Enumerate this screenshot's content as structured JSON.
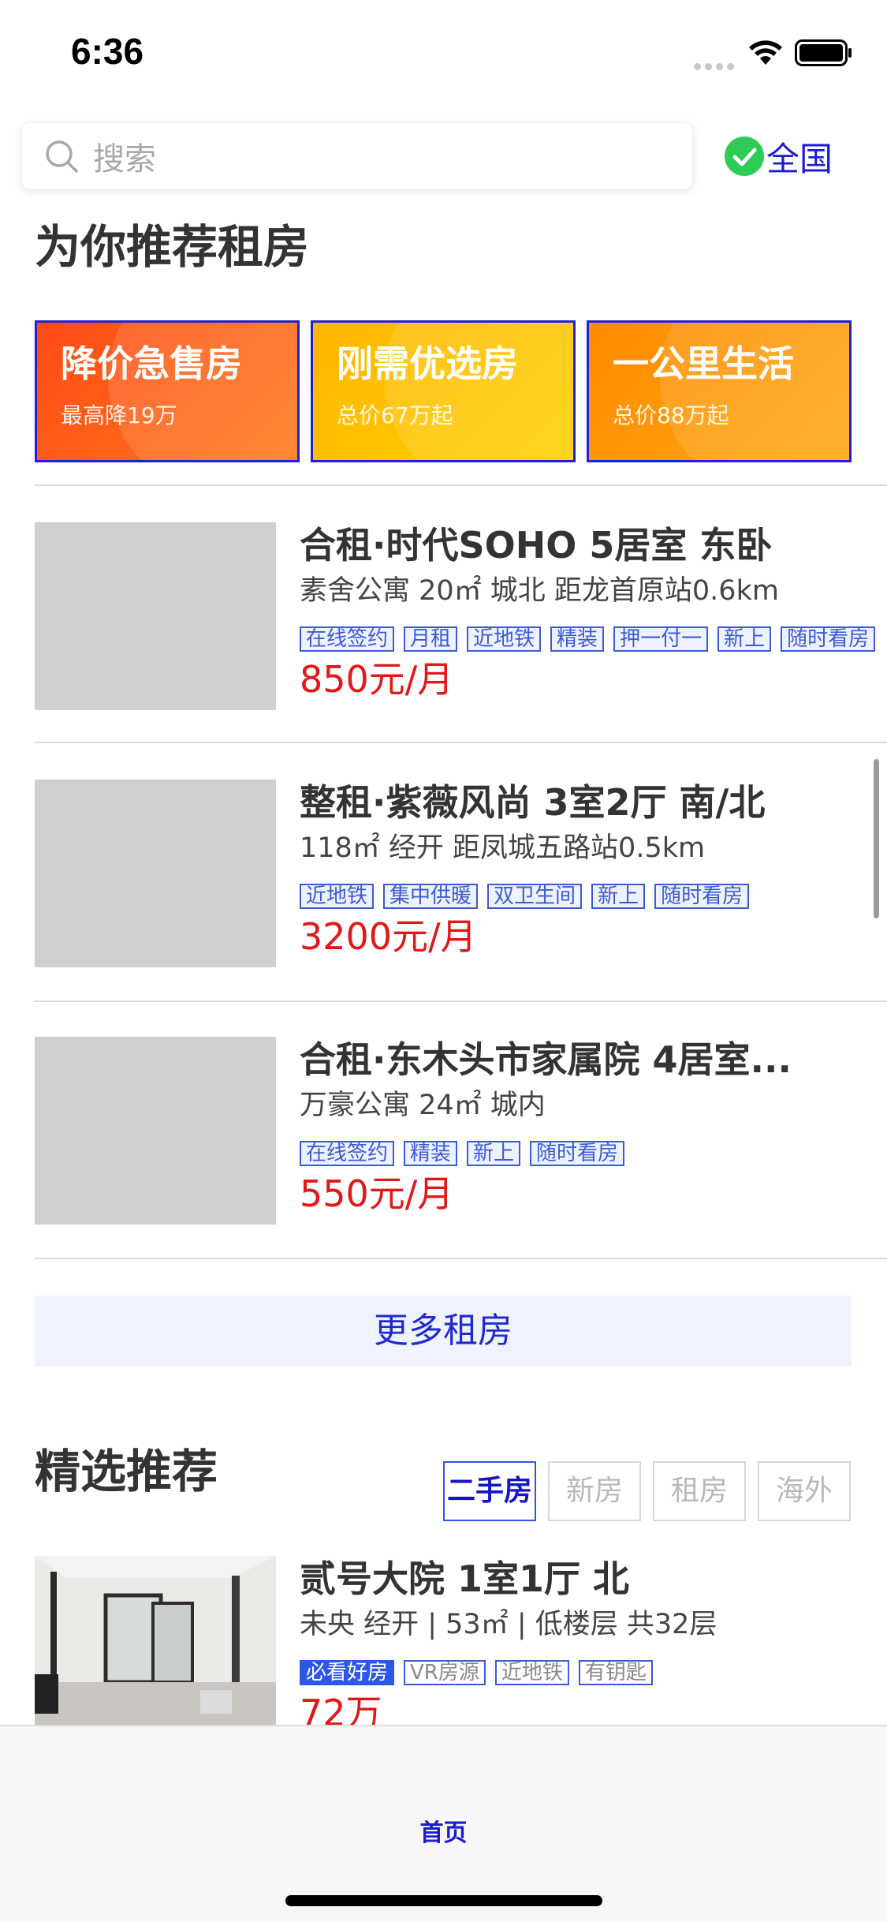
{
  "status_bar": {
    "time": "6:36"
  },
  "search": {
    "placeholder": "搜索"
  },
  "region": {
    "label": "全国"
  },
  "rent_section": {
    "title": "为你推荐租房"
  },
  "promos": [
    {
      "title": "降价急售房",
      "subtitle": "最高降19万",
      "color_from": "#ff4a16",
      "color_to": "#ff7a1a"
    },
    {
      "title": "刚需优选房",
      "subtitle": "总价67万起",
      "color_from": "#ffb600",
      "color_to": "#ffd000"
    },
    {
      "title": "一公里生活",
      "subtitle": "总价88万起",
      "color_from": "#ff8a00",
      "color_to": "#ffa812"
    }
  ],
  "listings": [
    {
      "title": "合租·时代SOHO 5居室 东卧",
      "subtitle": "素舍公寓  20㎡ 城北 距龙首原站0.6km",
      "tags": [
        "在线签约",
        "月租",
        "近地铁",
        "精装",
        "押一付一",
        "新上",
        "随时看房"
      ],
      "price": "850元/月"
    },
    {
      "title": "整租·紫薇风尚 3室2厅 南/北",
      "subtitle": " 118㎡ 经开 距凤城五路站0.5km",
      "tags": [
        "近地铁",
        "集中供暖",
        "双卫生间",
        "新上",
        "随时看房"
      ],
      "price": "3200元/月"
    },
    {
      "title": "合租·东木头市家属院 4居室...",
      "subtitle": "万豪公寓  24㎡ 城内",
      "tags": [
        "在线签约",
        "精装",
        "新上",
        "随时看房"
      ],
      "price": "550元/月"
    }
  ],
  "more_rent": {
    "label": "更多租房"
  },
  "featured": {
    "title": "精选推荐",
    "tabs": [
      "二手房",
      "新房",
      "租房",
      "海外"
    ],
    "active_tab": "二手房",
    "listing": {
      "title": "贰号大院 1室1厅 北",
      "subtitle": "未央 经开 | 53㎡ | 低楼层 共32层",
      "tags": [
        "必看好房",
        "VR房源",
        "近地铁",
        "有钥匙"
      ],
      "price_partial": "72万"
    }
  },
  "tab_bar": {
    "home_label": "首页"
  },
  "colors": {
    "accent": "#1c1ccf",
    "price": "#e21818",
    "tag_border": "#3b5bd6",
    "check": "#2ecc55"
  }
}
